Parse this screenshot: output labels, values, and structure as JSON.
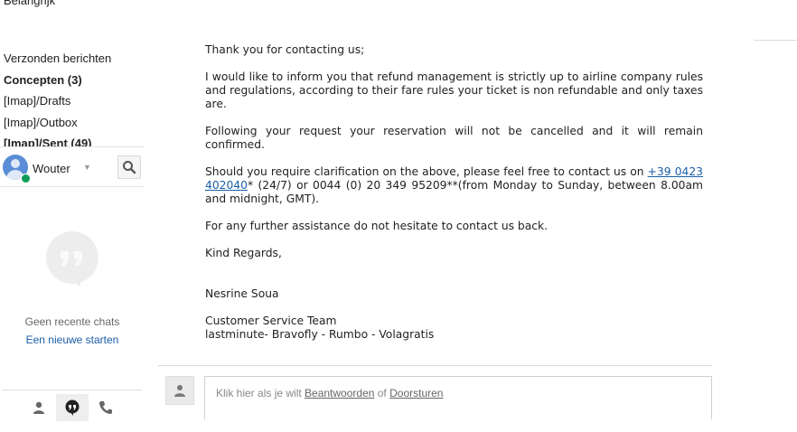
{
  "folders": [
    {
      "label": "Belangrijk",
      "bold": false
    },
    {
      "label": "Verzonden berichten",
      "bold": false
    },
    {
      "label": "Concepten (3)",
      "bold": true
    },
    {
      "label": "[Imap]/Drafts",
      "bold": false
    },
    {
      "label": "[Imap]/Outbox",
      "bold": false
    },
    {
      "label": "[Imap]/Sent (49)",
      "bold": true
    }
  ],
  "chat": {
    "user_name": "Wouter",
    "empty_text": "Geen recente chats",
    "start_new_link": "Een nieuwe starten",
    "presence_color": "#0f9d58"
  },
  "bottom_tabs": [
    {
      "icon": "person-icon",
      "active": false
    },
    {
      "icon": "hangouts-icon",
      "active": true
    },
    {
      "icon": "phone-icon",
      "active": false
    }
  ],
  "message": {
    "greeting": "Thank you for contacting us;",
    "para1": "I would like to inform you that refund management is strictly up to airline company rules and regulations, according to their fare rules your ticket is non refundable and only taxes are.",
    "para2": "Following your request your reservation will not be cancelled and it will remain confirmed.",
    "para3_before": "Should you require clarification on the above, please feel free to contact us on ",
    "phone_link": "+39 0423 402040",
    "para3_after": "* (24/7) or 0044 (0) 20 349 95209**(from Monday to Sunday, between 8.00am and midnight, GMT).",
    "para4": "For any further assistance do not hesitate to contact us back.",
    "closing": "Kind Regards,",
    "sender_name": "Nesrine Soua",
    "team": "Customer Service Team",
    "brands": "lastminute- Bravofly - Rumbo - Volagratis"
  },
  "reply": {
    "prefix": "Klik hier als je wilt ",
    "reply_link": "Beantwoorden",
    "middle": " of ",
    "forward_link": "Doorsturen"
  }
}
